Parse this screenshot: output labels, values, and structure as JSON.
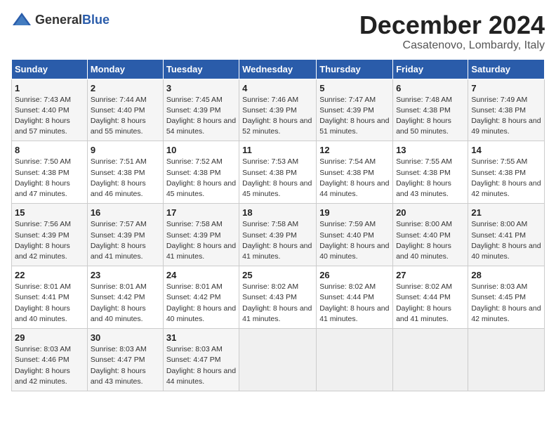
{
  "header": {
    "logo_general": "General",
    "logo_blue": "Blue",
    "month_title": "December 2024",
    "location": "Casatenovo, Lombardy, Italy"
  },
  "calendar": {
    "days_of_week": [
      "Sunday",
      "Monday",
      "Tuesday",
      "Wednesday",
      "Thursday",
      "Friday",
      "Saturday"
    ],
    "weeks": [
      [
        {
          "day": "",
          "empty": true
        },
        {
          "day": "",
          "empty": true
        },
        {
          "day": "",
          "empty": true
        },
        {
          "day": "",
          "empty": true
        },
        {
          "day": "",
          "empty": true
        },
        {
          "day": "",
          "empty": true
        },
        {
          "day": "",
          "empty": true
        }
      ],
      [
        {
          "day": "1",
          "sunrise": "7:43 AM",
          "sunset": "4:40 PM",
          "daylight": "8 hours and 57 minutes."
        },
        {
          "day": "2",
          "sunrise": "7:44 AM",
          "sunset": "4:40 PM",
          "daylight": "8 hours and 55 minutes."
        },
        {
          "day": "3",
          "sunrise": "7:45 AM",
          "sunset": "4:39 PM",
          "daylight": "8 hours and 54 minutes."
        },
        {
          "day": "4",
          "sunrise": "7:46 AM",
          "sunset": "4:39 PM",
          "daylight": "8 hours and 52 minutes."
        },
        {
          "day": "5",
          "sunrise": "7:47 AM",
          "sunset": "4:39 PM",
          "daylight": "8 hours and 51 minutes."
        },
        {
          "day": "6",
          "sunrise": "7:48 AM",
          "sunset": "4:38 PM",
          "daylight": "8 hours and 50 minutes."
        },
        {
          "day": "7",
          "sunrise": "7:49 AM",
          "sunset": "4:38 PM",
          "daylight": "8 hours and 49 minutes."
        }
      ],
      [
        {
          "day": "8",
          "sunrise": "7:50 AM",
          "sunset": "4:38 PM",
          "daylight": "8 hours and 47 minutes."
        },
        {
          "day": "9",
          "sunrise": "7:51 AM",
          "sunset": "4:38 PM",
          "daylight": "8 hours and 46 minutes."
        },
        {
          "day": "10",
          "sunrise": "7:52 AM",
          "sunset": "4:38 PM",
          "daylight": "8 hours and 45 minutes."
        },
        {
          "day": "11",
          "sunrise": "7:53 AM",
          "sunset": "4:38 PM",
          "daylight": "8 hours and 45 minutes."
        },
        {
          "day": "12",
          "sunrise": "7:54 AM",
          "sunset": "4:38 PM",
          "daylight": "8 hours and 44 minutes."
        },
        {
          "day": "13",
          "sunrise": "7:55 AM",
          "sunset": "4:38 PM",
          "daylight": "8 hours and 43 minutes."
        },
        {
          "day": "14",
          "sunrise": "7:55 AM",
          "sunset": "4:38 PM",
          "daylight": "8 hours and 42 minutes."
        }
      ],
      [
        {
          "day": "15",
          "sunrise": "7:56 AM",
          "sunset": "4:39 PM",
          "daylight": "8 hours and 42 minutes."
        },
        {
          "day": "16",
          "sunrise": "7:57 AM",
          "sunset": "4:39 PM",
          "daylight": "8 hours and 41 minutes."
        },
        {
          "day": "17",
          "sunrise": "7:58 AM",
          "sunset": "4:39 PM",
          "daylight": "8 hours and 41 minutes."
        },
        {
          "day": "18",
          "sunrise": "7:58 AM",
          "sunset": "4:39 PM",
          "daylight": "8 hours and 41 minutes."
        },
        {
          "day": "19",
          "sunrise": "7:59 AM",
          "sunset": "4:40 PM",
          "daylight": "8 hours and 40 minutes."
        },
        {
          "day": "20",
          "sunrise": "8:00 AM",
          "sunset": "4:40 PM",
          "daylight": "8 hours and 40 minutes."
        },
        {
          "day": "21",
          "sunrise": "8:00 AM",
          "sunset": "4:41 PM",
          "daylight": "8 hours and 40 minutes."
        }
      ],
      [
        {
          "day": "22",
          "sunrise": "8:01 AM",
          "sunset": "4:41 PM",
          "daylight": "8 hours and 40 minutes."
        },
        {
          "day": "23",
          "sunrise": "8:01 AM",
          "sunset": "4:42 PM",
          "daylight": "8 hours and 40 minutes."
        },
        {
          "day": "24",
          "sunrise": "8:01 AM",
          "sunset": "4:42 PM",
          "daylight": "8 hours and 40 minutes."
        },
        {
          "day": "25",
          "sunrise": "8:02 AM",
          "sunset": "4:43 PM",
          "daylight": "8 hours and 41 minutes."
        },
        {
          "day": "26",
          "sunrise": "8:02 AM",
          "sunset": "4:44 PM",
          "daylight": "8 hours and 41 minutes."
        },
        {
          "day": "27",
          "sunrise": "8:02 AM",
          "sunset": "4:44 PM",
          "daylight": "8 hours and 41 minutes."
        },
        {
          "day": "28",
          "sunrise": "8:03 AM",
          "sunset": "4:45 PM",
          "daylight": "8 hours and 42 minutes."
        }
      ],
      [
        {
          "day": "29",
          "sunrise": "8:03 AM",
          "sunset": "4:46 PM",
          "daylight": "8 hours and 42 minutes."
        },
        {
          "day": "30",
          "sunrise": "8:03 AM",
          "sunset": "4:47 PM",
          "daylight": "8 hours and 43 minutes."
        },
        {
          "day": "31",
          "sunrise": "8:03 AM",
          "sunset": "4:47 PM",
          "daylight": "8 hours and 44 minutes."
        },
        {
          "day": "",
          "empty": true
        },
        {
          "day": "",
          "empty": true
        },
        {
          "day": "",
          "empty": true
        },
        {
          "day": "",
          "empty": true
        }
      ]
    ]
  }
}
